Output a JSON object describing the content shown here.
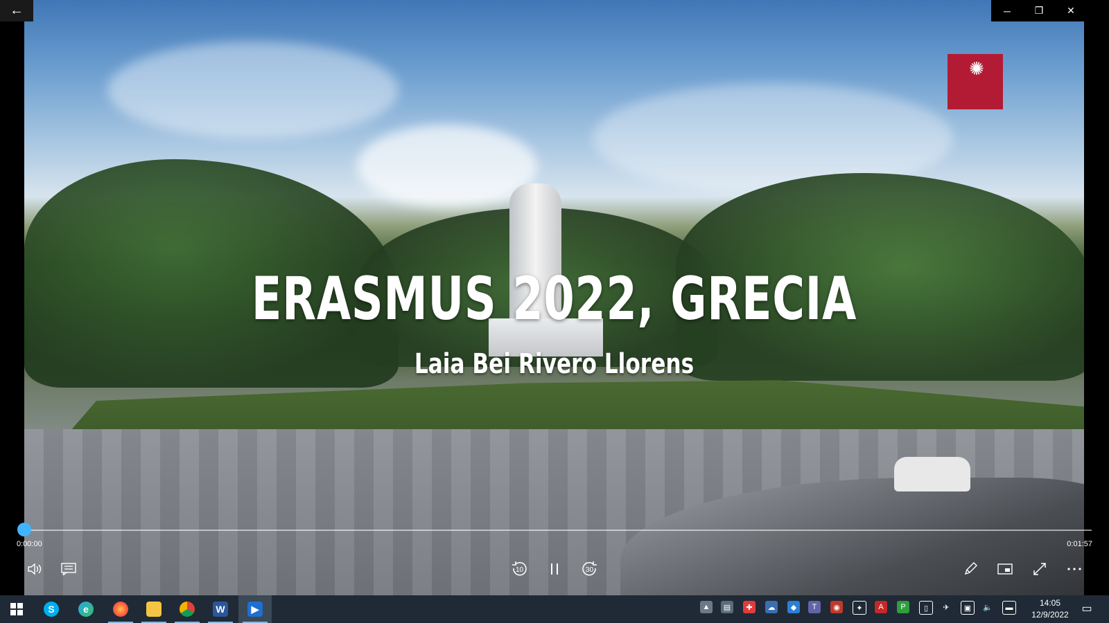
{
  "video": {
    "title": "ERASMUS 2022, GRECIA",
    "subtitle": "Laia Bei Rivero Llorens"
  },
  "window": {
    "back_icon": "←",
    "minimize_icon": "─",
    "restore_icon": "❐",
    "close_icon": "✕"
  },
  "player": {
    "current_time": "0:00:00",
    "total_time": "0:01:57",
    "progress": 0,
    "rewind_seconds": "10",
    "forward_seconds": "30",
    "accent_color": "#41b4ff"
  },
  "taskbar": {
    "apps": [
      {
        "name": "start",
        "icon": "windows-logo"
      },
      {
        "name": "skype",
        "icon": "S"
      },
      {
        "name": "edge",
        "icon": "e"
      },
      {
        "name": "firefox",
        "icon": "firefox"
      },
      {
        "name": "file-explorer",
        "icon": "folder"
      },
      {
        "name": "chrome",
        "icon": "chrome"
      },
      {
        "name": "word",
        "icon": "W"
      },
      {
        "name": "movies-tv",
        "icon": "play",
        "active": true
      }
    ],
    "clock_time": "14:05",
    "clock_date": "12/9/2022"
  }
}
